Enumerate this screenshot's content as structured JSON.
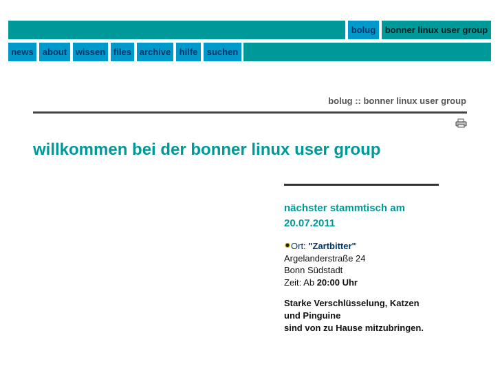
{
  "header": {
    "short_name": "bolug",
    "site_title": "bonner linux user group"
  },
  "nav": [
    {
      "label": "news"
    },
    {
      "label": "about"
    },
    {
      "label": "wissen"
    },
    {
      "label": "files"
    },
    {
      "label": "archive"
    },
    {
      "label": "hilfe"
    },
    {
      "label": "suchen"
    }
  ],
  "breadcrumb": "bolug :: bonner linux user group",
  "page_title": "willkommen bei der bonner linux user group",
  "sidebar": {
    "heading_line1": "nächster stammtisch am",
    "heading_line2": "20.07.2011",
    "ort_label": "Ort:",
    "ort_name": "\"Zartbitter\"",
    "street": "Argelanderstraße 24",
    "city": "Bonn Südstadt",
    "zeit_label": "Zeit: Ab",
    "zeit_value": "20:00 Uhr",
    "note_line1": "Starke Verschlüsselung, Katzen",
    "note_line2": "und Pinguine",
    "note_line3": "sind von zu Hause mitzubringen."
  },
  "colors": {
    "teal": "#009999",
    "blue": "#0099cc",
    "nav_text": "#003366"
  }
}
